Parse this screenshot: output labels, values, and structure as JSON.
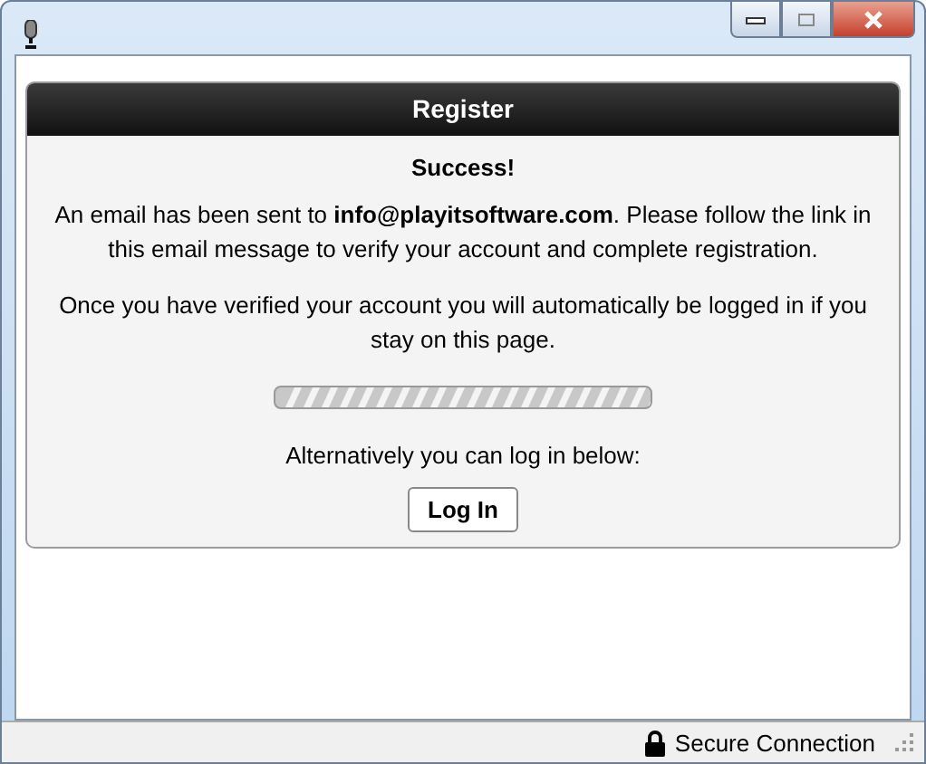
{
  "panel": {
    "title": "Register",
    "heading": "Success!",
    "message": "An email has been sent to **info@playitsoftware.com**. Please follow the link in this email message to verify your account and complete registration.",
    "note": "Once you have verified your account you will automatically be logged in if you stay on this page.",
    "alternative": "Alternatively you can log in below:",
    "button": "Log In"
  },
  "status_bar": {
    "text": "Secure Connection"
  }
}
